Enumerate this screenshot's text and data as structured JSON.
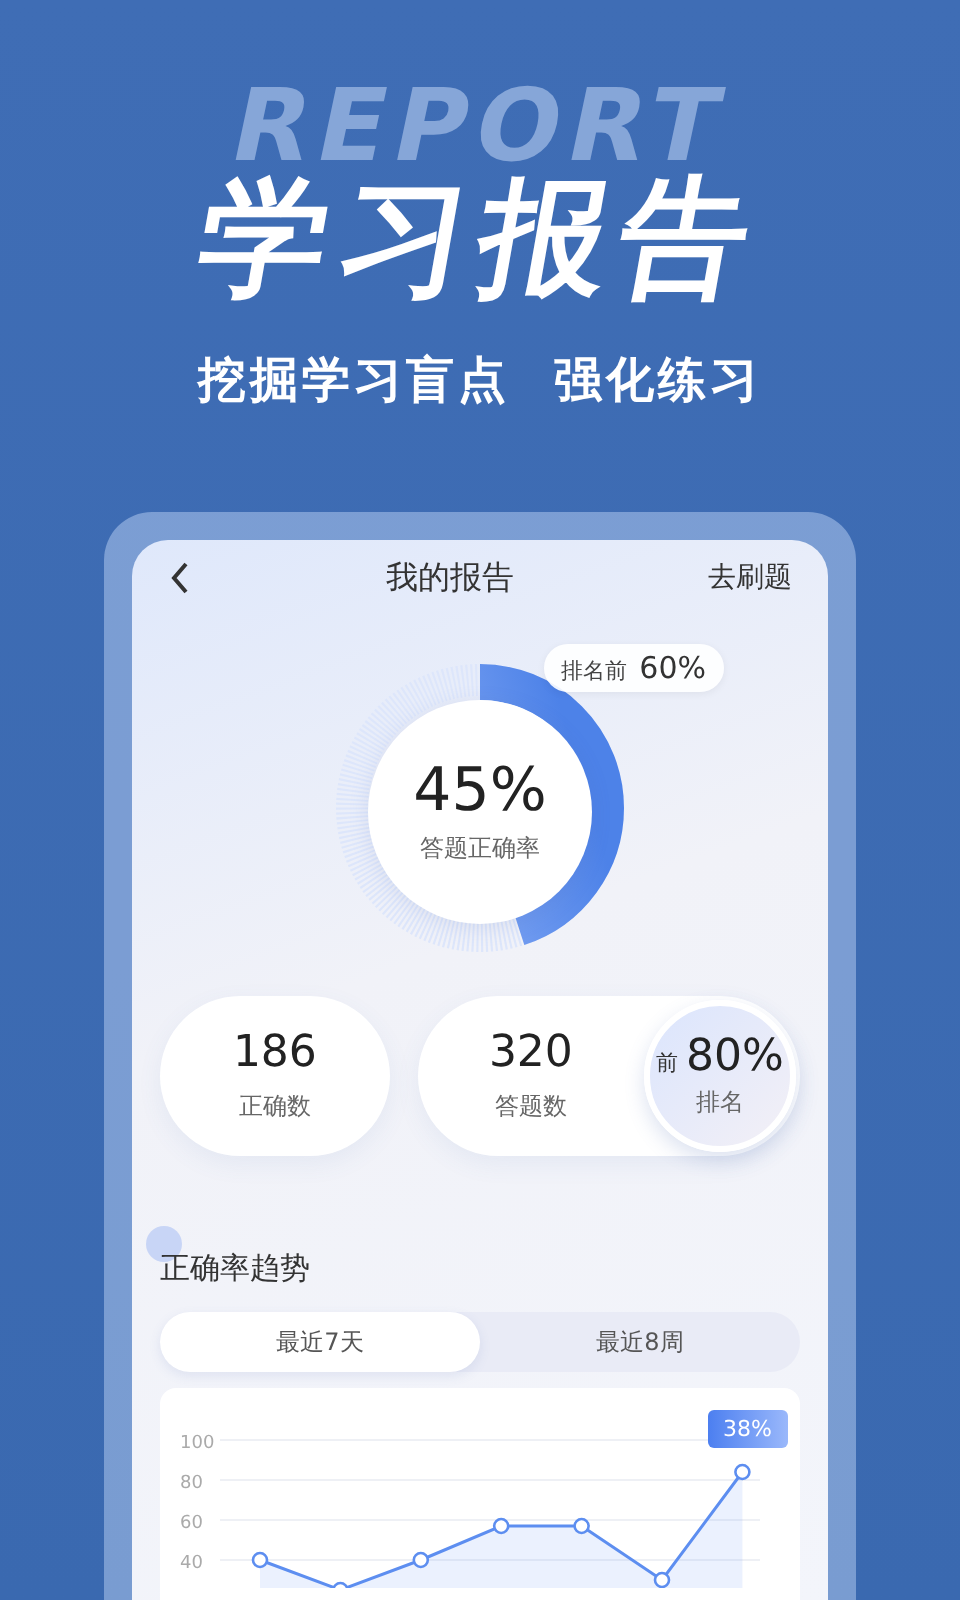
{
  "banner": {
    "background_word": "REPORT",
    "title": "学习报告",
    "subtitle": [
      "挖掘学习盲点",
      "强化练习"
    ]
  },
  "screen": {
    "title": "我的报告",
    "action": "去刷题"
  },
  "accuracy": {
    "value": "45%",
    "label": "答题正确率",
    "level": 0.45,
    "rank_prefix": "排名前",
    "rank": "60%"
  },
  "stats": [
    {
      "kind": "plain",
      "value": "186",
      "label": "正确数"
    },
    {
      "kind": "ranked",
      "value": "320",
      "label": "答题数",
      "rank_prefix": "前",
      "rank": "80%",
      "rank_label": "排名"
    }
  ],
  "trend": {
    "title": "正确率趋势",
    "tabs": [
      {
        "label": "最近7天",
        "selected": true
      },
      {
        "label": "最近8周",
        "selected": false
      }
    ],
    "chart_data": {
      "type": "area",
      "ylim": [
        0,
        100
      ],
      "yticks": [
        100,
        80,
        60,
        40
      ],
      "grid": true,
      "values": [
        40,
        25,
        40,
        57,
        57,
        30,
        84
      ]
    },
    "badge": "38%"
  }
}
